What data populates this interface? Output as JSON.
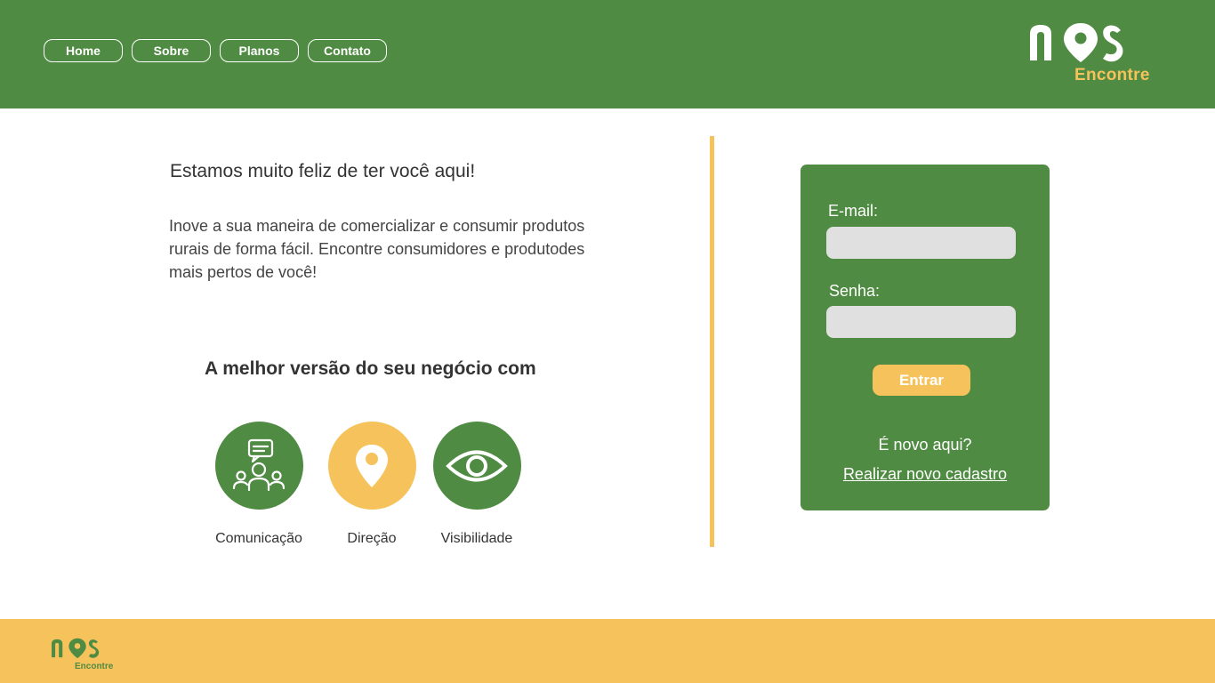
{
  "header": {
    "nav": [
      {
        "label": "Home"
      },
      {
        "label": "Sobre"
      },
      {
        "label": "Planos"
      },
      {
        "label": "Contato"
      }
    ],
    "logo": {
      "mark": "nos",
      "word": "Encontre"
    }
  },
  "main": {
    "welcome_title": "Estamos muito feliz de ter você aqui!",
    "intro": "Inove a sua maneira de comercializar e consumir produtos rurais de forma fácil. Encontre consumidores e produtodes mais pertos de você!",
    "better_title": "A melhor versão do seu negócio com",
    "features": [
      {
        "label": "Comunicação",
        "icon": "people-chat-icon",
        "color": "#4f8b42"
      },
      {
        "label": "Direção",
        "icon": "location-pin-icon",
        "color": "#f6c25b"
      },
      {
        "label": "Visibilidade",
        "icon": "eye-icon",
        "color": "#4f8b42"
      }
    ]
  },
  "login": {
    "email_label": "E-mail:",
    "email_value": "",
    "password_label": "Senha:",
    "password_value": "",
    "submit_label": "Entrar",
    "new_here": "É novo aqui?",
    "register_link": "Realizar novo cadastro"
  },
  "footer": {
    "logo": {
      "mark": "nos",
      "word": "Encontre"
    }
  },
  "colors": {
    "primary_green": "#4f8b42",
    "accent_yellow": "#f6c25b",
    "input_gray": "#e0e0e0"
  }
}
